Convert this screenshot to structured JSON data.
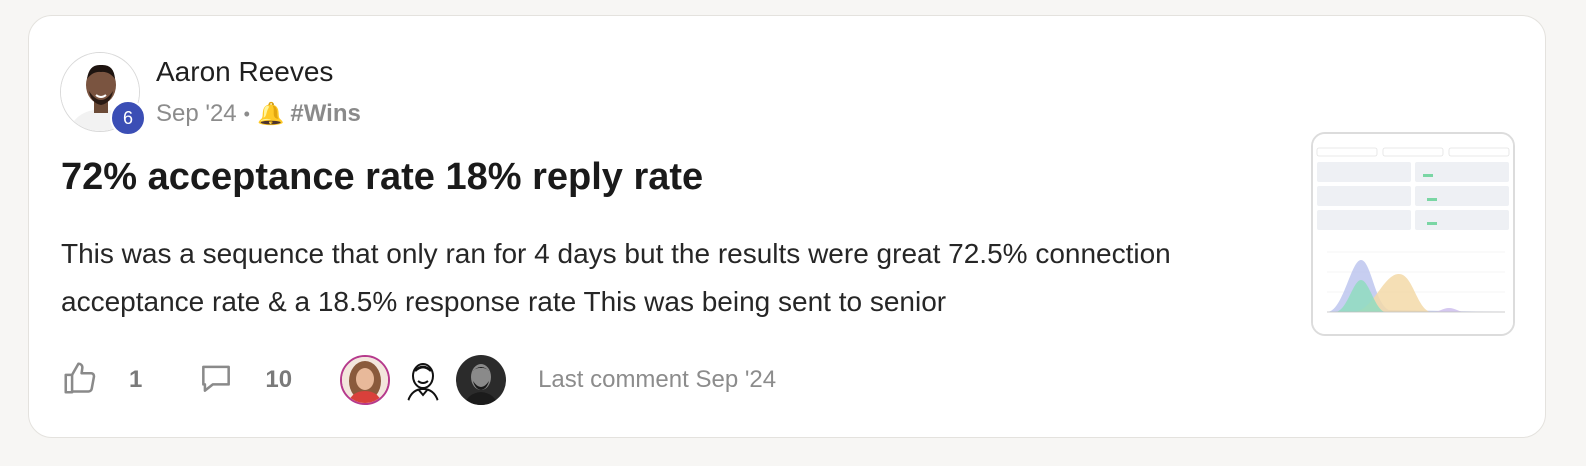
{
  "post": {
    "author": {
      "name": "Aaron Reeves",
      "level": "6"
    },
    "date": "Sep '24",
    "separator": "•",
    "category_icon": "bell-icon",
    "category": "#Wins",
    "title": "72% acceptance rate 18% reply rate",
    "body": "This was a sequence that only ran for 4 days but the results were great 72.5% connection acceptance rate & a 18.5% response rate This was being sent to senior",
    "thumbnail": "dashboard-screenshot-thumbnail"
  },
  "footer": {
    "likes": "1",
    "comments": "10",
    "last_comment": "Last comment Sep '24",
    "participants": [
      "participant-avatar-1",
      "participant-avatar-2",
      "participant-avatar-3"
    ]
  },
  "colors": {
    "card_bg": "#ffffff",
    "page_bg": "#f7f6f4",
    "badge": "#3b4eb5",
    "muted_text": "#8c8c8c"
  }
}
